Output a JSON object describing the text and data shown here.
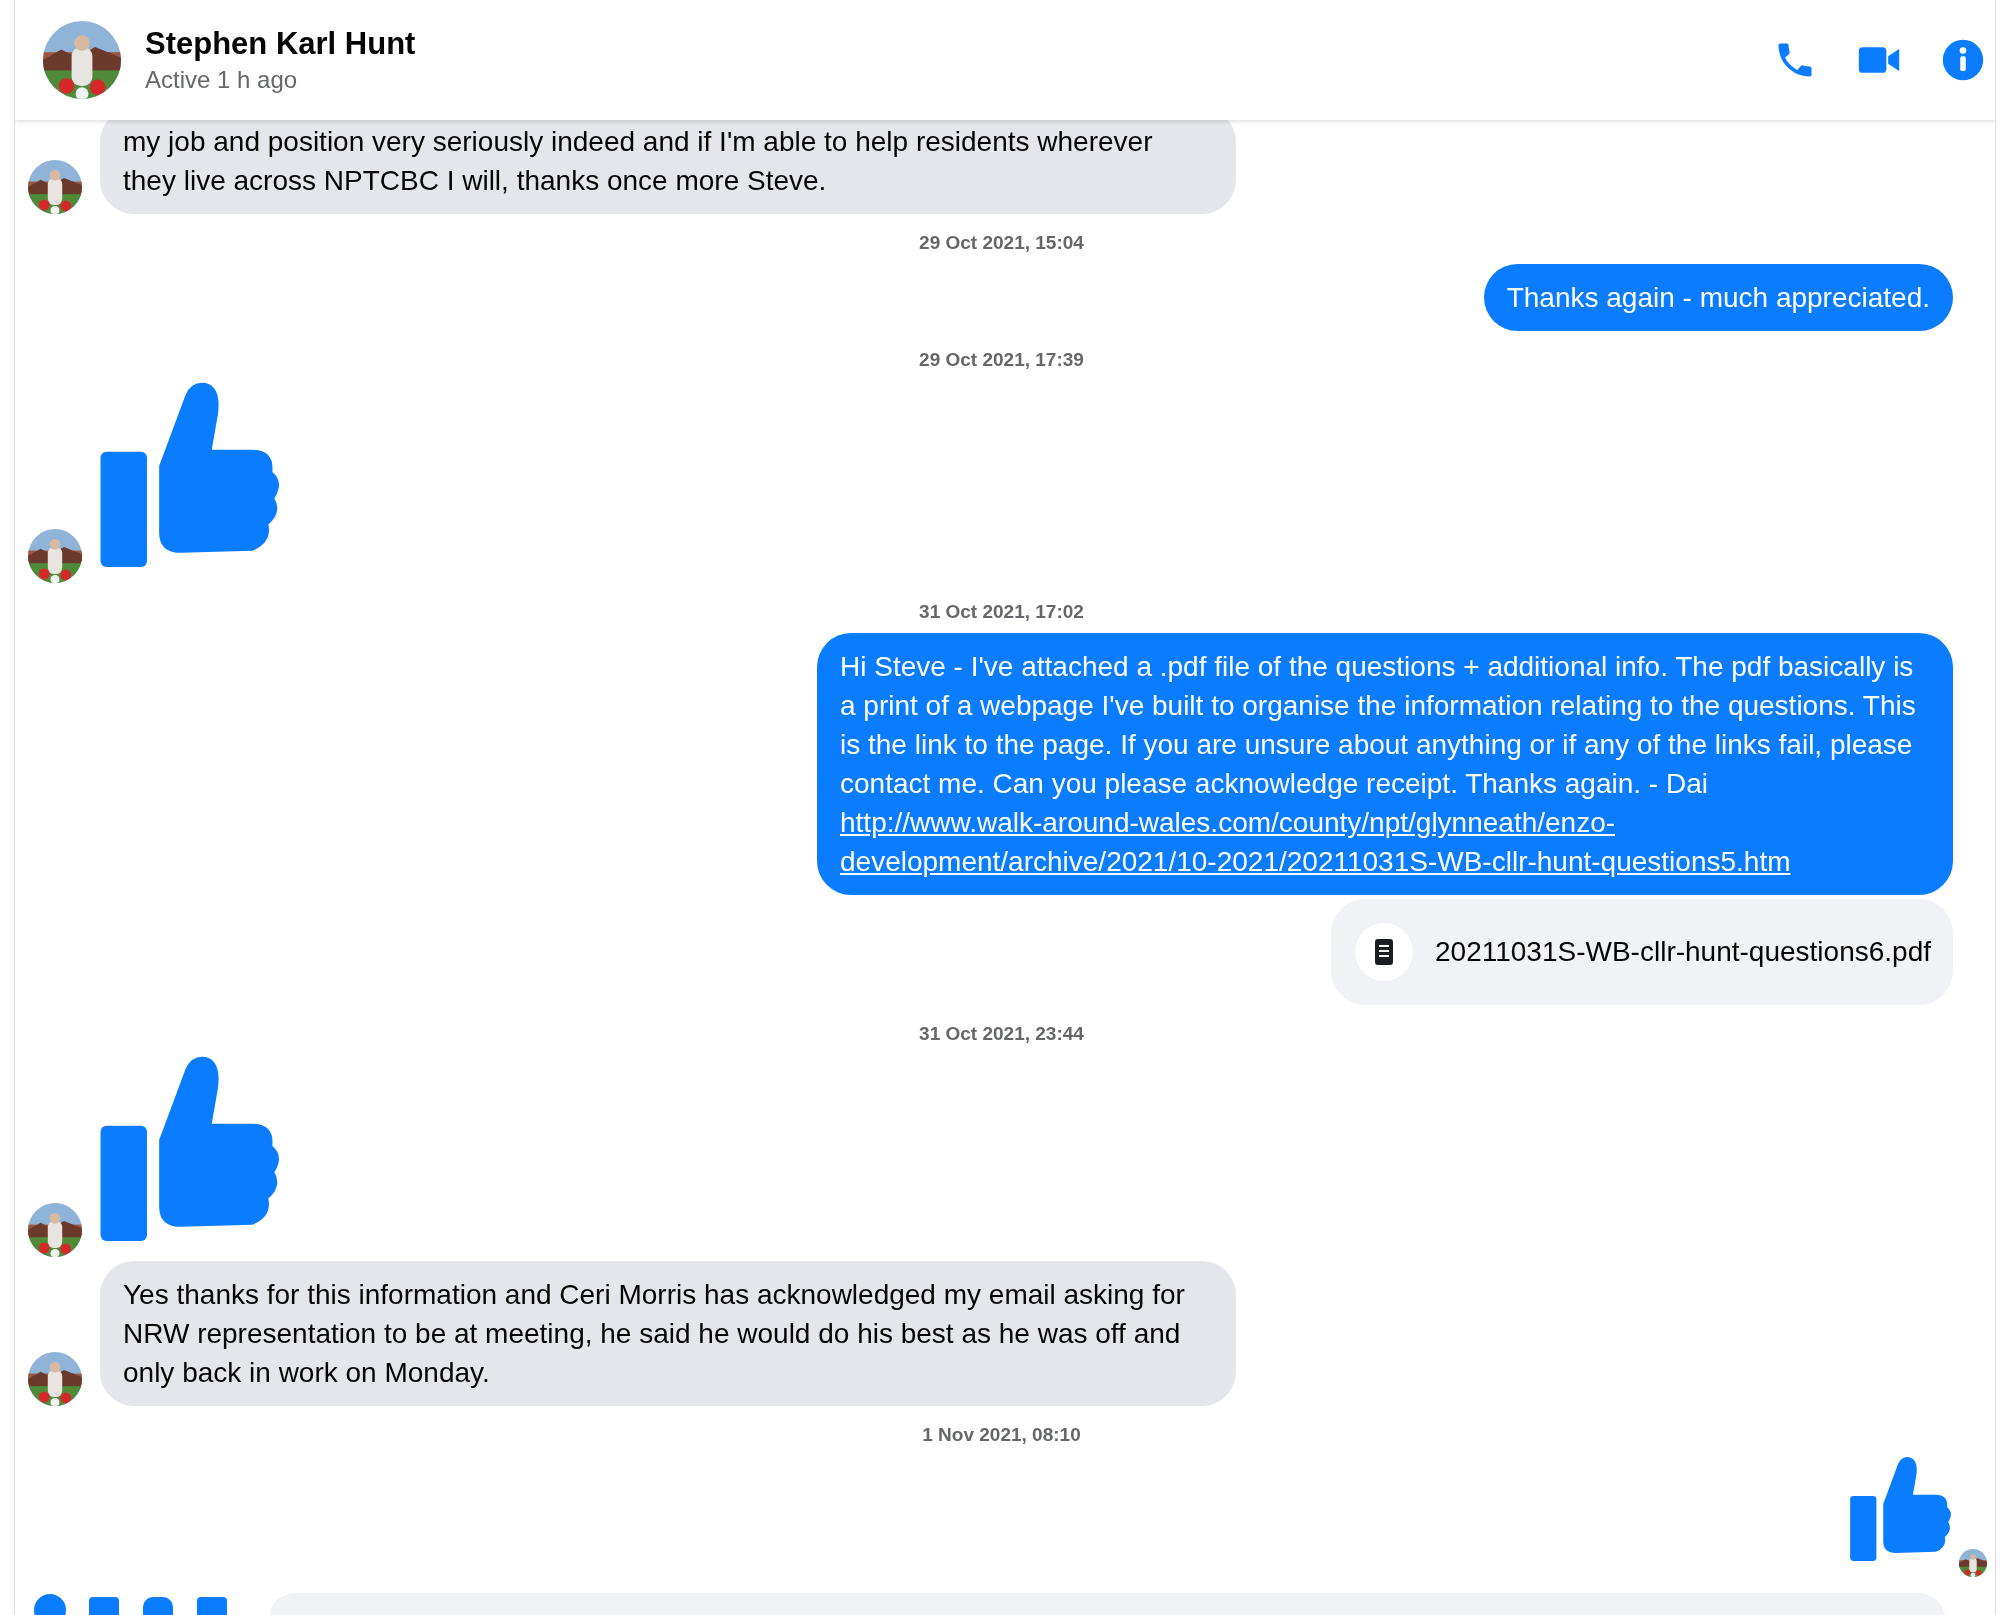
{
  "header": {
    "name": "Stephen Karl Hunt",
    "status": "Active 1 h ago"
  },
  "messages": [
    {
      "kind": "text",
      "sent": false,
      "avatar": true,
      "text": "my job and position very seriously indeed and if I'm able to help residents wherever they live across NPTCBC I will, thanks once more Steve."
    },
    {
      "kind": "timestamp",
      "text": "29 Oct 2021, 15:04"
    },
    {
      "kind": "text",
      "sent": true,
      "text": "Thanks again - much appreciated."
    },
    {
      "kind": "timestamp",
      "text": "29 Oct 2021, 17:39"
    },
    {
      "kind": "biglike",
      "sent": false,
      "avatar": true
    },
    {
      "kind": "timestamp",
      "text": "31 Oct 2021, 17:02"
    },
    {
      "kind": "text",
      "sent": true,
      "text": "Hi Steve - I've attached a .pdf file of the questions + additional info. The pdf basically is a print of a webpage I've built to organise the information relating to the questions. This is the link to the page. If you are unsure about anything or if any of the links fail, please contact me. Can you please acknowledge receipt. Thanks again. - Dai",
      "link": "http://www.walk-around-wales.com/county/npt/glynneath/enzo-development/archive/2021/10-2021/20211031S-WB-cllr-hunt-questions5.htm"
    },
    {
      "kind": "file",
      "sent": true,
      "text": "20211031S-WB-cllr-hunt-questions6.pdf"
    },
    {
      "kind": "timestamp",
      "text": "31 Oct 2021, 23:44"
    },
    {
      "kind": "biglike",
      "sent": false,
      "avatar": true
    },
    {
      "kind": "text",
      "sent": false,
      "avatar": true,
      "text": "Yes thanks for this information and Ceri Morris has acknowledged my email asking for NRW representation to be at meeting, he said he would do his best as he was off and only back in work on Monday."
    },
    {
      "kind": "timestamp",
      "text": "1 Nov 2021, 08:10"
    },
    {
      "kind": "like",
      "sent": true,
      "seen": true
    }
  ]
}
